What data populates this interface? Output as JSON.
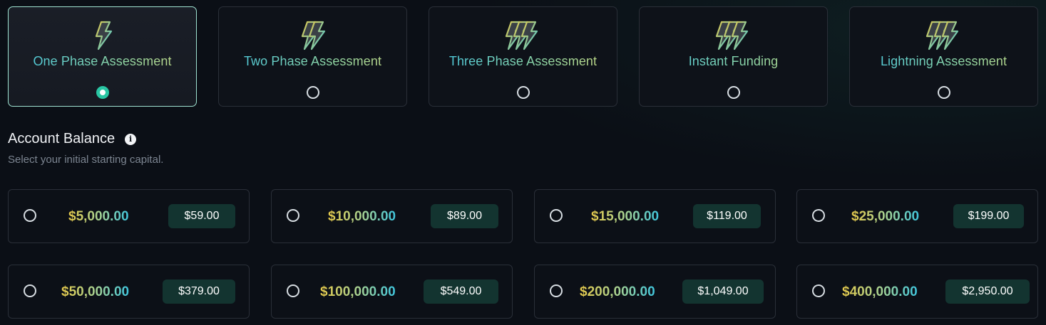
{
  "plans": {
    "items": [
      {
        "label": "One Phase Assessment",
        "icon": "single-bolt-icon",
        "selected": true
      },
      {
        "label": "Two Phase Assessment",
        "icon": "double-bolt-icon",
        "selected": false
      },
      {
        "label": "Three Phase Assessment",
        "icon": "triple-bolt-icon",
        "selected": false
      },
      {
        "label": "Instant Funding",
        "icon": "triple-bolt-icon",
        "selected": false
      },
      {
        "label": "Lightning Assessment",
        "icon": "triple-bolt-icon",
        "selected": false
      }
    ]
  },
  "account_balance": {
    "title": "Account Balance",
    "info_icon": "info-icon",
    "subtitle": "Select your initial starting capital.",
    "options": [
      {
        "amount": "$5,000.00",
        "price": "$59.00"
      },
      {
        "amount": "$10,000.00",
        "price": "$89.00"
      },
      {
        "amount": "$15,000.00",
        "price": "$119.00"
      },
      {
        "amount": "$25,000.00",
        "price": "$199.00"
      },
      {
        "amount": "$50,000.00",
        "price": "$379.00"
      },
      {
        "amount": "$100,000.00",
        "price": "$549.00"
      },
      {
        "amount": "$200,000.00",
        "price": "$1,049.00"
      },
      {
        "amount": "$400,000.00",
        "price": "$2,950.00"
      }
    ]
  },
  "colors": {
    "accent_teal": "#29c6a3",
    "selected_border": "#9fe3d2",
    "price_badge_bg": "#133430",
    "gradient_gold": "#e5c84a",
    "gradient_cyan": "#3fc6de"
  }
}
